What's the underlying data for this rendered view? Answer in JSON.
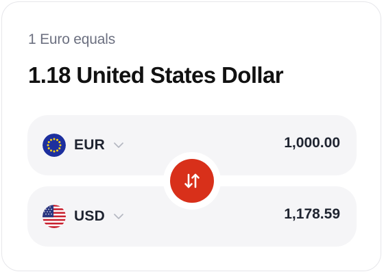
{
  "header": {
    "subtitle": "1 Euro equals",
    "rate_text": "1.18 United States Dollar"
  },
  "from": {
    "code": "EUR",
    "amount": "1,000.00",
    "flag_icon": "eu-flag-icon"
  },
  "to": {
    "code": "USD",
    "amount": "1,178.59",
    "flag_icon": "us-flag-icon"
  },
  "swap": {
    "icon": "swap-arrows-icon",
    "color": "#d8301a"
  },
  "colors": {
    "row_background": "#f5f5f7",
    "text_primary": "#1f2430",
    "text_secondary": "#6c7080",
    "card_border": "#e6e6ea"
  }
}
